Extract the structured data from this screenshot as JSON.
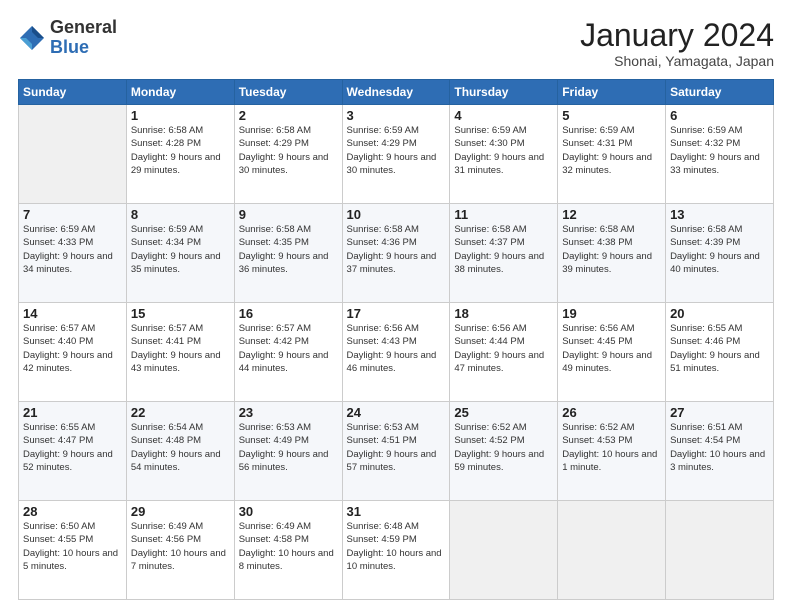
{
  "header": {
    "logo": {
      "general": "General",
      "blue": "Blue"
    },
    "title": "January 2024",
    "subtitle": "Shonai, Yamagata, Japan"
  },
  "calendar": {
    "days_of_week": [
      "Sunday",
      "Monday",
      "Tuesday",
      "Wednesday",
      "Thursday",
      "Friday",
      "Saturday"
    ],
    "weeks": [
      [
        {
          "day": null,
          "sunrise": null,
          "sunset": null,
          "daylight": null
        },
        {
          "day": "1",
          "sunrise": "6:58 AM",
          "sunset": "4:28 PM",
          "daylight": "9 hours and 29 minutes."
        },
        {
          "day": "2",
          "sunrise": "6:58 AM",
          "sunset": "4:29 PM",
          "daylight": "9 hours and 30 minutes."
        },
        {
          "day": "3",
          "sunrise": "6:59 AM",
          "sunset": "4:29 PM",
          "daylight": "9 hours and 30 minutes."
        },
        {
          "day": "4",
          "sunrise": "6:59 AM",
          "sunset": "4:30 PM",
          "daylight": "9 hours and 31 minutes."
        },
        {
          "day": "5",
          "sunrise": "6:59 AM",
          "sunset": "4:31 PM",
          "daylight": "9 hours and 32 minutes."
        },
        {
          "day": "6",
          "sunrise": "6:59 AM",
          "sunset": "4:32 PM",
          "daylight": "9 hours and 33 minutes."
        }
      ],
      [
        {
          "day": "7",
          "sunrise": "6:59 AM",
          "sunset": "4:33 PM",
          "daylight": "9 hours and 34 minutes."
        },
        {
          "day": "8",
          "sunrise": "6:59 AM",
          "sunset": "4:34 PM",
          "daylight": "9 hours and 35 minutes."
        },
        {
          "day": "9",
          "sunrise": "6:58 AM",
          "sunset": "4:35 PM",
          "daylight": "9 hours and 36 minutes."
        },
        {
          "day": "10",
          "sunrise": "6:58 AM",
          "sunset": "4:36 PM",
          "daylight": "9 hours and 37 minutes."
        },
        {
          "day": "11",
          "sunrise": "6:58 AM",
          "sunset": "4:37 PM",
          "daylight": "9 hours and 38 minutes."
        },
        {
          "day": "12",
          "sunrise": "6:58 AM",
          "sunset": "4:38 PM",
          "daylight": "9 hours and 39 minutes."
        },
        {
          "day": "13",
          "sunrise": "6:58 AM",
          "sunset": "4:39 PM",
          "daylight": "9 hours and 40 minutes."
        }
      ],
      [
        {
          "day": "14",
          "sunrise": "6:57 AM",
          "sunset": "4:40 PM",
          "daylight": "9 hours and 42 minutes."
        },
        {
          "day": "15",
          "sunrise": "6:57 AM",
          "sunset": "4:41 PM",
          "daylight": "9 hours and 43 minutes."
        },
        {
          "day": "16",
          "sunrise": "6:57 AM",
          "sunset": "4:42 PM",
          "daylight": "9 hours and 44 minutes."
        },
        {
          "day": "17",
          "sunrise": "6:56 AM",
          "sunset": "4:43 PM",
          "daylight": "9 hours and 46 minutes."
        },
        {
          "day": "18",
          "sunrise": "6:56 AM",
          "sunset": "4:44 PM",
          "daylight": "9 hours and 47 minutes."
        },
        {
          "day": "19",
          "sunrise": "6:56 AM",
          "sunset": "4:45 PM",
          "daylight": "9 hours and 49 minutes."
        },
        {
          "day": "20",
          "sunrise": "6:55 AM",
          "sunset": "4:46 PM",
          "daylight": "9 hours and 51 minutes."
        }
      ],
      [
        {
          "day": "21",
          "sunrise": "6:55 AM",
          "sunset": "4:47 PM",
          "daylight": "9 hours and 52 minutes."
        },
        {
          "day": "22",
          "sunrise": "6:54 AM",
          "sunset": "4:48 PM",
          "daylight": "9 hours and 54 minutes."
        },
        {
          "day": "23",
          "sunrise": "6:53 AM",
          "sunset": "4:49 PM",
          "daylight": "9 hours and 56 minutes."
        },
        {
          "day": "24",
          "sunrise": "6:53 AM",
          "sunset": "4:51 PM",
          "daylight": "9 hours and 57 minutes."
        },
        {
          "day": "25",
          "sunrise": "6:52 AM",
          "sunset": "4:52 PM",
          "daylight": "9 hours and 59 minutes."
        },
        {
          "day": "26",
          "sunrise": "6:52 AM",
          "sunset": "4:53 PM",
          "daylight": "10 hours and 1 minute."
        },
        {
          "day": "27",
          "sunrise": "6:51 AM",
          "sunset": "4:54 PM",
          "daylight": "10 hours and 3 minutes."
        }
      ],
      [
        {
          "day": "28",
          "sunrise": "6:50 AM",
          "sunset": "4:55 PM",
          "daylight": "10 hours and 5 minutes."
        },
        {
          "day": "29",
          "sunrise": "6:49 AM",
          "sunset": "4:56 PM",
          "daylight": "10 hours and 7 minutes."
        },
        {
          "day": "30",
          "sunrise": "6:49 AM",
          "sunset": "4:58 PM",
          "daylight": "10 hours and 8 minutes."
        },
        {
          "day": "31",
          "sunrise": "6:48 AM",
          "sunset": "4:59 PM",
          "daylight": "10 hours and 10 minutes."
        },
        {
          "day": null,
          "sunrise": null,
          "sunset": null,
          "daylight": null
        },
        {
          "day": null,
          "sunrise": null,
          "sunset": null,
          "daylight": null
        },
        {
          "day": null,
          "sunrise": null,
          "sunset": null,
          "daylight": null
        }
      ]
    ],
    "labels": {
      "sunrise": "Sunrise:",
      "sunset": "Sunset:",
      "daylight": "Daylight:"
    }
  }
}
